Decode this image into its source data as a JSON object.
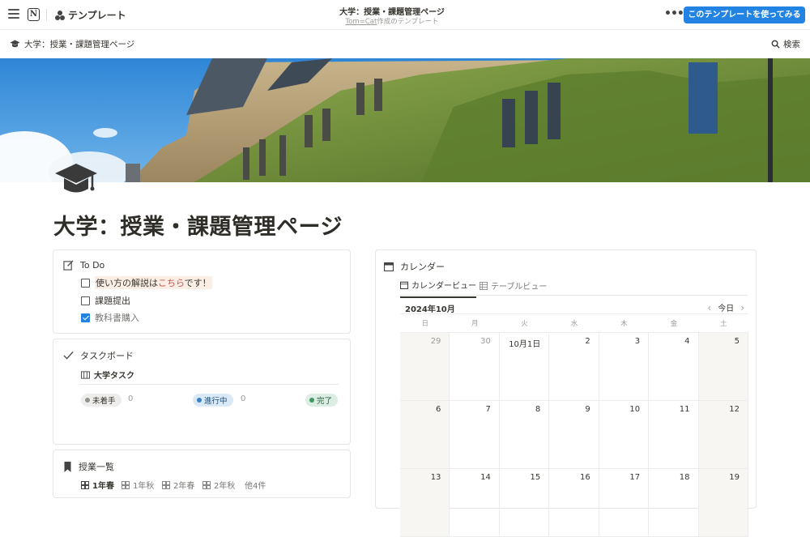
{
  "topbar": {
    "workspace_label": "テンプレート",
    "page_title": "大学：授業・課題管理ページ",
    "author": "Tom=Cat",
    "author_suffix": "作成のテンプレート",
    "use_button": "このテンプレートを使ってみる",
    "brand_color": "#2383e2"
  },
  "breadcrumb": {
    "label": "大学：授業・課題管理ページ"
  },
  "search": {
    "label": "検索"
  },
  "page": {
    "title": "大学：授業・課題管理ページ",
    "icon": "graduation-cap-icon"
  },
  "todo": {
    "heading": "To Do",
    "items": [
      {
        "label_plain": "使い方の解説は",
        "label_link": "こちら",
        "label_tail": "です！",
        "checked": false
      },
      {
        "label": "課題提出",
        "checked": false
      },
      {
        "label": "教科書購入",
        "checked": true
      }
    ]
  },
  "taskboard": {
    "heading": "タスクボード",
    "view_label": "大学タスク",
    "statuses": [
      {
        "label": "未着手",
        "count": "0"
      },
      {
        "label": "進行中",
        "count": "0"
      },
      {
        "label": "完了",
        "count": ""
      }
    ]
  },
  "classes": {
    "heading": "授業一覧",
    "tabs": [
      "1年春",
      "1年秋",
      "2年春",
      "2年秋",
      "他4件"
    ]
  },
  "calendar": {
    "heading": "カレンダー",
    "tabs": [
      "カレンダービュー",
      "テーブルビュー"
    ],
    "month": "2024年10月",
    "today": "今日",
    "weekdays": [
      "日",
      "月",
      "火",
      "水",
      "木",
      "金",
      "土"
    ],
    "weeks": [
      [
        "29",
        "30",
        "10月1日",
        "2",
        "3",
        "4",
        "5"
      ],
      [
        "6",
        "7",
        "8",
        "9",
        "10",
        "11",
        "12"
      ],
      [
        "13",
        "14",
        "15",
        "16",
        "17",
        "18",
        "19"
      ]
    ]
  }
}
